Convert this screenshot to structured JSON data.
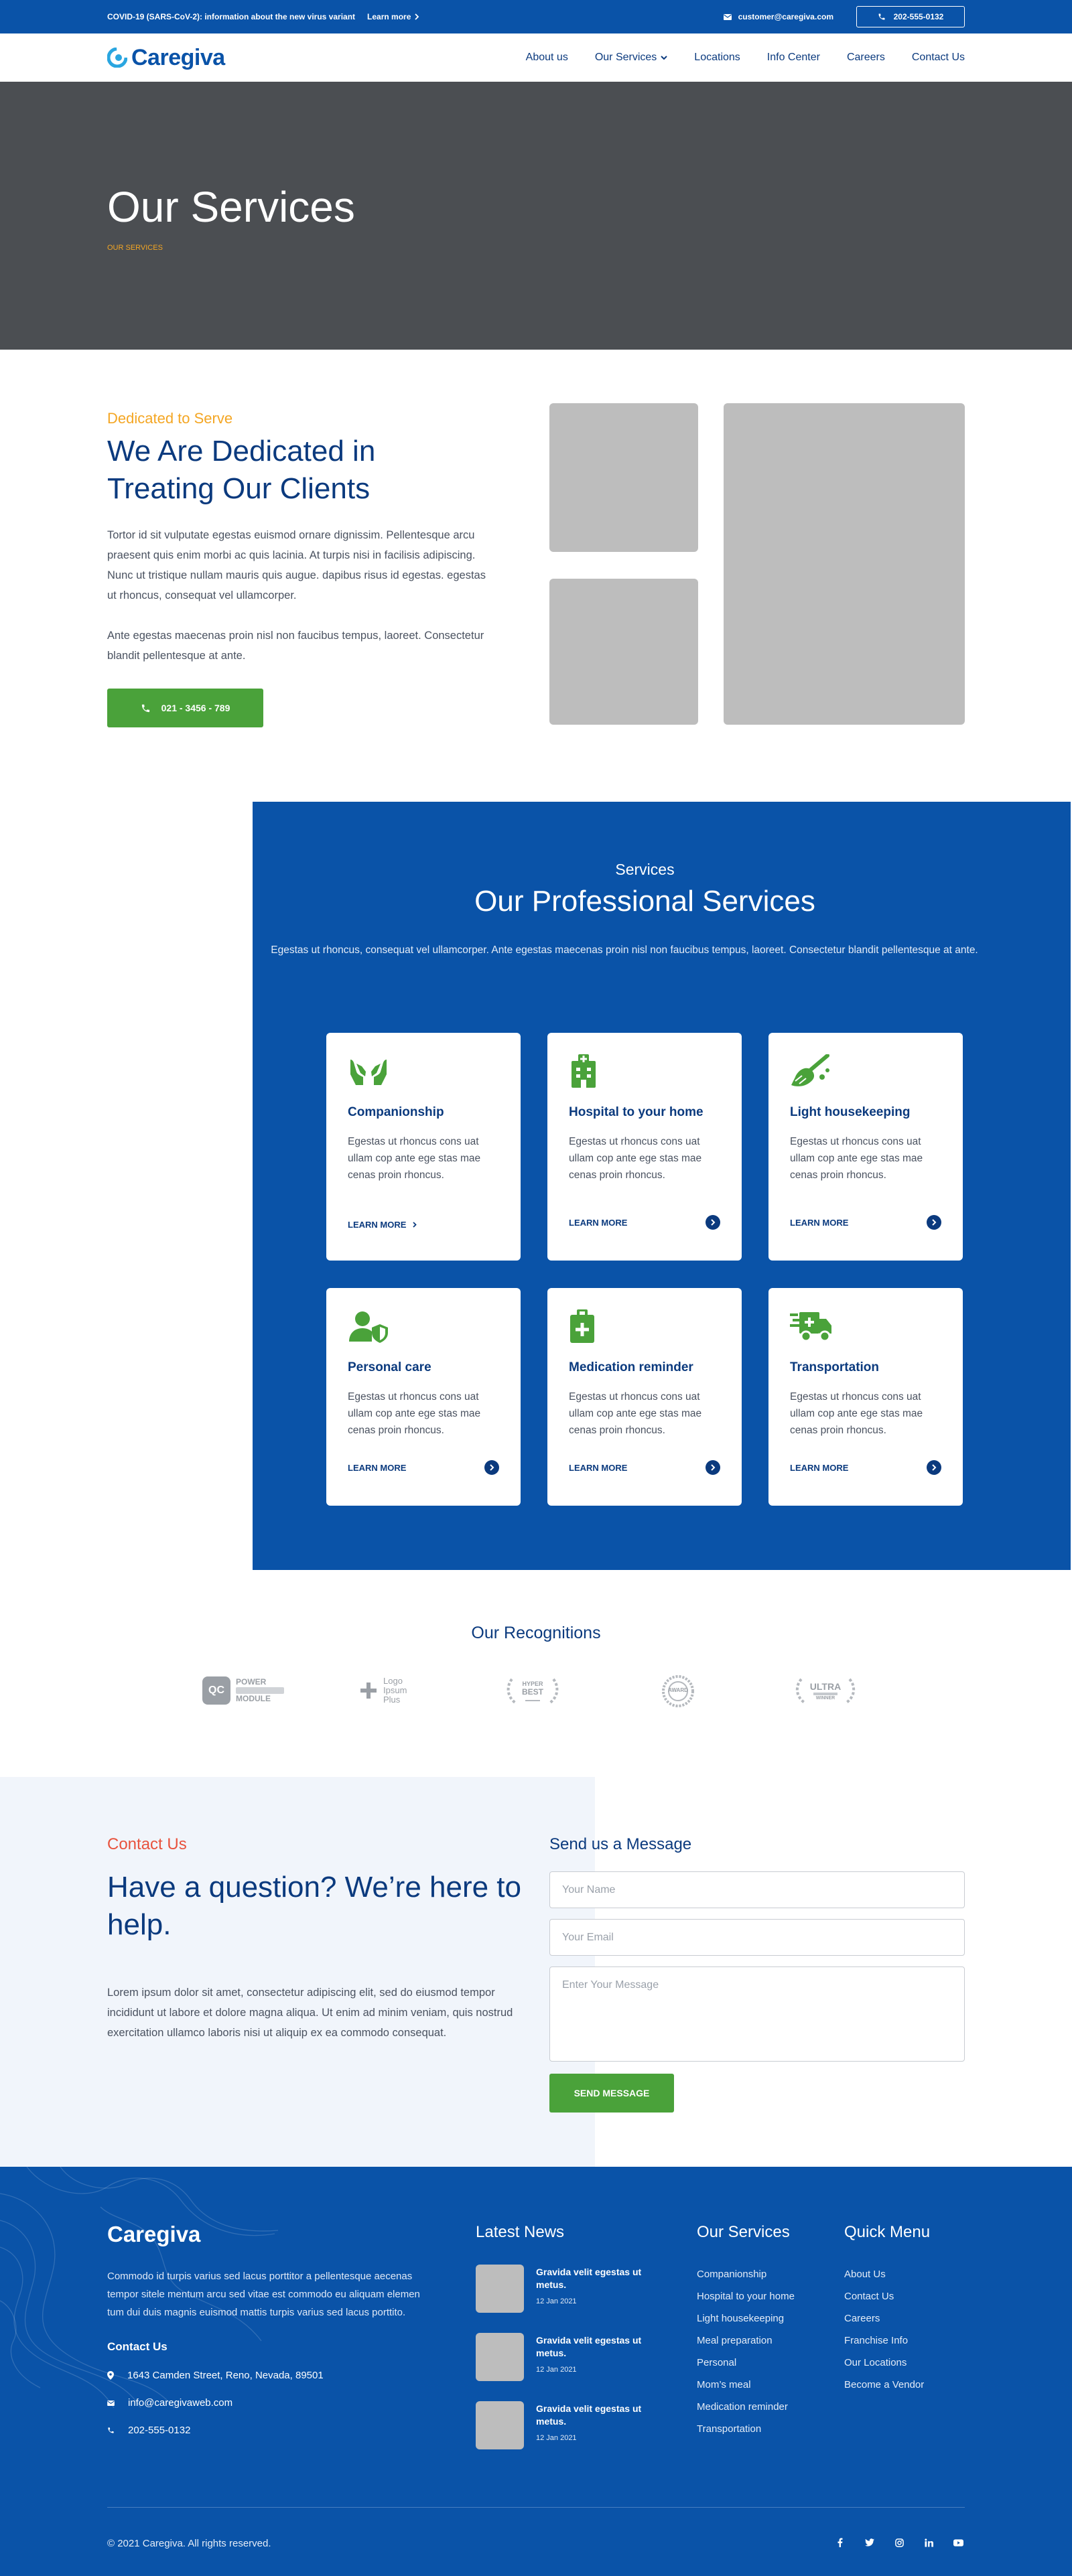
{
  "topbar": {
    "covid_text": "COVID-19 (SARS-CoV-2): information about the new virus variant",
    "learn_more": "Learn more",
    "email": "customer@caregiva.com",
    "phone": "202-555-0132"
  },
  "nav": {
    "logo": "Caregiva",
    "items": [
      "About us",
      "Our Services",
      "Locations",
      "Info Center",
      "Careers",
      "Contact Us"
    ]
  },
  "hero": {
    "title": "Our Services",
    "breadcrumb": "OUR SERVICES"
  },
  "dedicated": {
    "eyebrow": "Dedicated to Serve",
    "title": "We Are Dedicated in Treating Our Clients",
    "p1": "Tortor id sit vulputate egestas euismod ornare dignissim. Pellentesque arcu praesent quis enim morbi ac quis lacinia. At turpis nisi in facilisis adipiscing. Nunc ut tristique nullam mauris quis augue. dapibus risus id egestas. egestas ut rhoncus, consequat vel ullamcorper.",
    "p2": "Ante egestas maecenas proin nisl non faucibus tempus, laoreet. Consectetur blandit pellentesque at ante.",
    "phone_button": "021 - 3456 - 789"
  },
  "services": {
    "eyebrow": "Services",
    "title": "Our Professional Services",
    "description": "Egestas ut rhoncus, consequat vel ullamcorper. Ante egestas maecenas proin nisl non faucibus tempus, laoreet. Consectetur blandit pellentesque at ante.",
    "cards": [
      {
        "title": "Companionship",
        "text": "Egestas ut rhoncus cons uat ullam cop ante ege stas mae cenas proin rhoncus.",
        "link": "LEARN MORE",
        "icon": "hands-icon"
      },
      {
        "title": "Hospital to your home",
        "text": "Egestas ut rhoncus cons uat ullam cop ante ege stas mae cenas proin rhoncus.",
        "link": "LEARN MORE",
        "icon": "hospital-icon"
      },
      {
        "title": "Light housekeeping",
        "text": "Egestas ut rhoncus cons uat ullam cop ante ege stas mae cenas proin rhoncus.",
        "link": "LEARN MORE",
        "icon": "broom-icon"
      },
      {
        "title": "Personal care",
        "text": "Egestas ut rhoncus cons uat ullam cop ante ege stas mae cenas proin rhoncus.",
        "link": "LEARN MORE",
        "icon": "user-shield-icon"
      },
      {
        "title": "Medication reminder",
        "text": "Egestas ut rhoncus cons uat ullam cop ante ege stas mae cenas proin rhoncus.",
        "link": "LEARN MORE",
        "icon": "medkit-icon"
      },
      {
        "title": "Transportation",
        "text": "Egestas ut rhoncus cons uat ullam cop ante ege stas mae cenas proin rhoncus.",
        "link": "LEARN MORE",
        "icon": "truck-icon"
      }
    ]
  },
  "recognitions": {
    "title": "Our Recognitions",
    "logos": [
      {
        "main": "QC",
        "line1": "POWER",
        "line2": "MODULE"
      },
      {
        "main": "Logo",
        "line1": "Ipsum",
        "line2": "Plus"
      },
      {
        "main": "HYPER",
        "line1": "BEST"
      },
      {
        "main": "AWARD"
      },
      {
        "main": "ULTRA",
        "line1": "WINNER"
      }
    ]
  },
  "contact": {
    "eyebrow": "Contact Us",
    "title": "Have a question? We’re here to help.",
    "text": "Lorem ipsum dolor sit amet, consectetur adipiscing elit, sed do eiusmod tempor incididunt ut labore et dolore magna aliqua. Ut enim ad minim veniam, quis nostrud exercitation ullamco laboris nisi ut aliquip ex ea commodo consequat.",
    "form_title": "Send us a Message",
    "name_placeholder": "Your Name",
    "email_placeholder": "Your Email",
    "message_placeholder": "Enter Your Message",
    "send": "SEND MESSAGE"
  },
  "footer": {
    "logo": "Caregiva",
    "description": "Commodo id turpis varius sed lacus porttitor a pellentesque aecenas tempor sitele mentum arcu sed vitae est commodo eu aliquam elemen tum dui duis magnis euismod mattis turpis varius sed lacus porttito.",
    "contact_heading": "Contact Us",
    "address": "1643  Camden Street, Reno, Nevada, 89501",
    "email": "info@caregivaweb.com",
    "phone": "202-555-0132",
    "news_heading": "Latest News",
    "news": [
      {
        "title": "Gravida velit egestas ut metus.",
        "date": "12 Jan 2021"
      },
      {
        "title": "Gravida velit egestas ut metus.",
        "date": "12 Jan 2021"
      },
      {
        "title": "Gravida velit egestas ut metus.",
        "date": "12 Jan 2021"
      }
    ],
    "services_heading": "Our Services",
    "services_links": [
      "Companionship",
      "Hospital to your home",
      "Light housekeeping",
      "Meal preparation",
      "Personal",
      "Mom’s meal",
      "Medication reminder",
      "Transportation"
    ],
    "quick_heading": "Quick Menu",
    "quick_links": [
      "About Us",
      "Contact Us",
      "Careers",
      "Franchise Info",
      "Our Locations",
      "Become a Vendor"
    ],
    "copyright": "© 2021 Caregiva. All rights reserved.",
    "socials": [
      "facebook-icon",
      "twitter-icon",
      "instagram-icon",
      "linkedin-icon",
      "youtube-icon"
    ]
  },
  "colors": {
    "brand_blue": "#0a53a8",
    "navy": "#0b3a7e",
    "green": "#4aa23a",
    "orange": "#f4a623",
    "coral": "#e8523d"
  }
}
